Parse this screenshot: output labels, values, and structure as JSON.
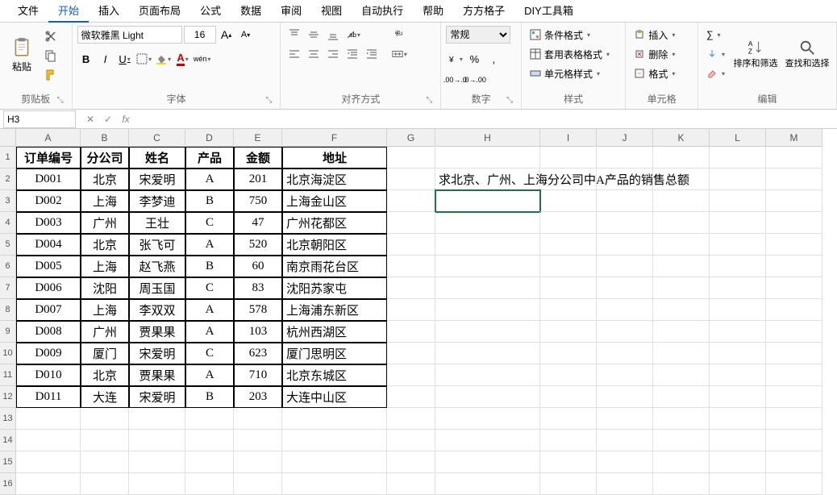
{
  "tabs": [
    "文件",
    "开始",
    "插入",
    "页面布局",
    "公式",
    "数据",
    "审阅",
    "视图",
    "自动执行",
    "帮助",
    "方方格子",
    "DIY工具箱"
  ],
  "activeTab": 1,
  "clipboard": {
    "paste": "粘贴",
    "label": "剪贴板"
  },
  "font": {
    "name": "微软雅黑 Light",
    "size": "16",
    "bold": "B",
    "italic": "I",
    "underline": "U",
    "label": "字体",
    "wen": "wén"
  },
  "alignment": {
    "label": "对齐方式"
  },
  "number": {
    "format": "常规",
    "label": "数字"
  },
  "styles": {
    "cond": "条件格式",
    "table": "套用表格格式",
    "cell": "单元格样式",
    "label": "样式"
  },
  "cells": {
    "insert": "插入",
    "delete": "删除",
    "format": "格式",
    "label": "单元格"
  },
  "editing": {
    "sort": "排序和筛选",
    "find": "查找和选择",
    "label": "编辑"
  },
  "namebox": "H3",
  "columns": [
    "A",
    "B",
    "C",
    "D",
    "E",
    "F",
    "G",
    "H",
    "I",
    "J",
    "K",
    "L",
    "M"
  ],
  "headers": [
    "订单编号",
    "分公司",
    "姓名",
    "产品",
    "金额",
    "地址"
  ],
  "rows": [
    [
      "D001",
      "北京",
      "宋爱明",
      "A",
      "201",
      "北京海淀区"
    ],
    [
      "D002",
      "上海",
      "李梦迪",
      "B",
      "750",
      "上海金山区"
    ],
    [
      "D003",
      "广州",
      "王壮",
      "C",
      "47",
      "广州花都区"
    ],
    [
      "D004",
      "北京",
      "张飞可",
      "A",
      "520",
      "北京朝阳区"
    ],
    [
      "D005",
      "上海",
      "赵飞燕",
      "B",
      "60",
      "南京雨花台区"
    ],
    [
      "D006",
      "沈阳",
      "周玉国",
      "C",
      "83",
      "沈阳苏家屯"
    ],
    [
      "D007",
      "上海",
      "李双双",
      "A",
      "578",
      "上海浦东新区"
    ],
    [
      "D008",
      "广州",
      "贾果果",
      "A",
      "103",
      "杭州西湖区"
    ],
    [
      "D009",
      "厦门",
      "宋爱明",
      "C",
      "623",
      "厦门思明区"
    ],
    [
      "D010",
      "北京",
      "贾果果",
      "A",
      "710",
      "北京东城区"
    ],
    [
      "D011",
      "大连",
      "宋爱明",
      "B",
      "203",
      "大连中山区"
    ]
  ],
  "note": "求北京、广州、上海分公司中A产品的销售总额",
  "fx": "fx",
  "incA": "A",
  "decA": "A"
}
